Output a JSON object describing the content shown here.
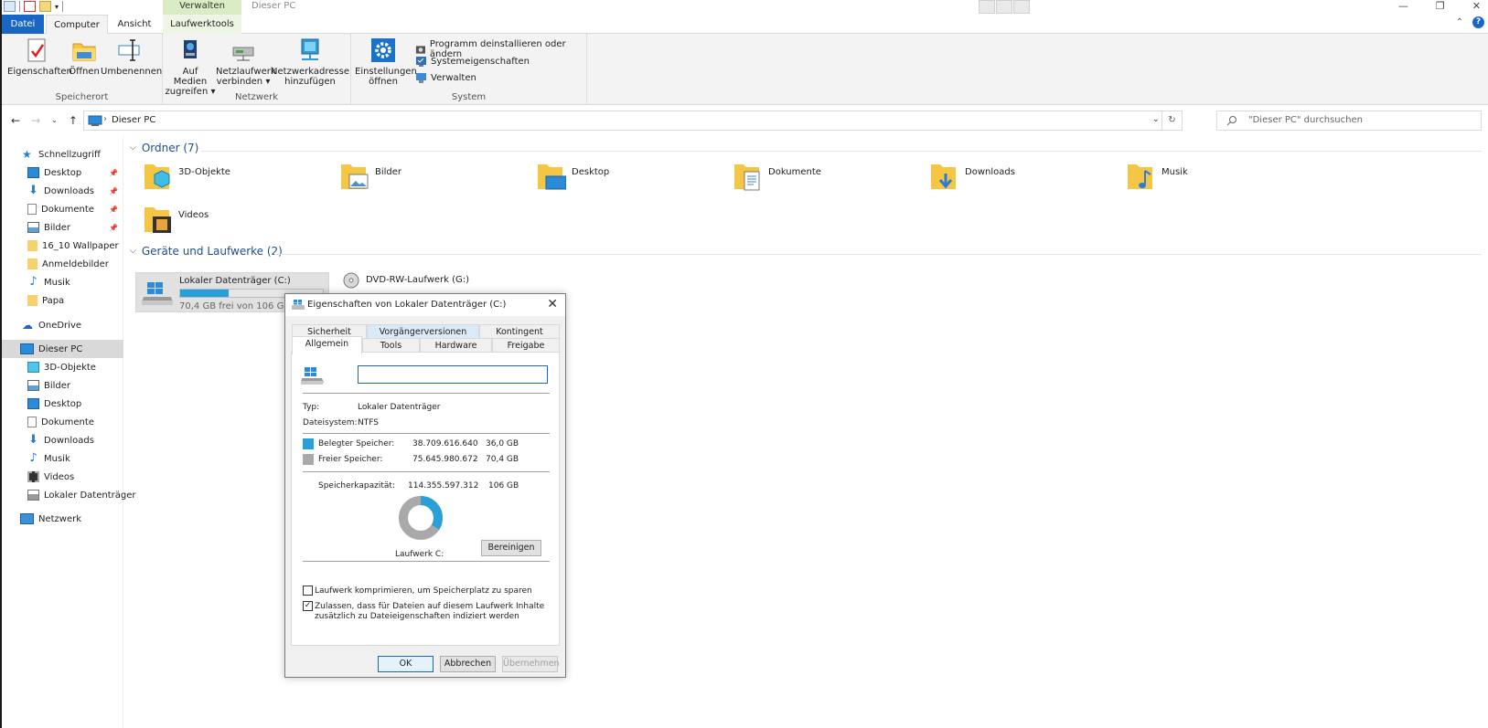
{
  "window": {
    "title": "Dieser PC",
    "context_tab_header": "Verwalten"
  },
  "tabs": {
    "datei": "Datei",
    "computer": "Computer",
    "ansicht": "Ansicht",
    "laufwerktools": "Laufwerktools"
  },
  "ribbon": {
    "groups": {
      "speicherort": "Speicherort",
      "netzwerk": "Netzwerk",
      "system": "System"
    },
    "buttons": {
      "eigenschaften": "Eigenschaften",
      "oeffnen": "Öffnen",
      "umbenennen": "Umbenennen",
      "auf_medien_1": "Auf Medien",
      "auf_medien_2": "zugreifen ▾",
      "netzlaufwerk_1": "Netzlaufwerk",
      "netzlaufwerk_2": "verbinden ▾",
      "netzwerkadresse_1": "Netzwerkadresse",
      "netzwerkadresse_2": "hinzufügen",
      "einstellungen_1": "Einstellungen",
      "einstellungen_2": "öffnen",
      "programm": "Programm deinstallieren oder ändern",
      "systemeigenschaften": "Systemeigenschaften",
      "verwalten": "Verwalten"
    }
  },
  "address": {
    "crumb": "Dieser PC",
    "search_placeholder": "\"Dieser PC\" durchsuchen"
  },
  "nav": {
    "schnellzugriff": "Schnellzugriff",
    "desktop": "Desktop",
    "downloads": "Downloads",
    "dokumente": "Dokumente",
    "bilder": "Bilder",
    "wallpaper": "16_10 Wallpaper",
    "anmeldebilder": "Anmeldebilder",
    "musik": "Musik",
    "papa": "Papa",
    "onedrive": "OneDrive",
    "dieser_pc": "Dieser PC",
    "objekte3d": "3D-Objekte",
    "bilder2": "Bilder",
    "desktop2": "Desktop",
    "dokumente2": "Dokumente",
    "downloads2": "Downloads",
    "musik2": "Musik",
    "videos": "Videos",
    "lokaler": "Lokaler Datenträger",
    "netzwerk": "Netzwerk"
  },
  "sections": {
    "ordner": "Ordner (7)",
    "geraete": "Geräte und Laufwerke (2)"
  },
  "folders": {
    "f1": "3D-Objekte",
    "f2": "Bilder",
    "f3": "Desktop",
    "f4": "Dokumente",
    "f5": "Downloads",
    "f6": "Musik",
    "f7": "Videos"
  },
  "drives": {
    "c_name": "Lokaler Datenträger (C:)",
    "c_free": "70,4 GB frei von 106 GB",
    "c_used_fraction": 0.34,
    "dvd_name": "DVD-RW-Laufwerk (G:)"
  },
  "dialog": {
    "title": "Eigenschaften von Lokaler Datenträger (C:)",
    "tabs": {
      "sicherheit": "Sicherheit",
      "vorgaenger": "Vorgängerversionen",
      "kontingent": "Kontingent",
      "allgemein": "Allgemein",
      "tools": "Tools",
      "hardware": "Hardware",
      "freigabe": "Freigabe"
    },
    "name_value": "",
    "typ_label": "Typ:",
    "typ_value": "Lokaler Datenträger",
    "fs_label": "Dateisystem:",
    "fs_value": "NTFS",
    "used_label": "Belegter Speicher:",
    "used_bytes": "38.709.616.640",
    "used_gb": "36,0 GB",
    "free_label": "Freier Speicher:",
    "free_bytes": "75.645.980.672",
    "free_gb": "70,4 GB",
    "cap_label": "Speicherkapazität:",
    "cap_bytes": "114.355.597.312",
    "cap_gb": "106 GB",
    "drive_label": "Laufwerk C:",
    "bereinigen": "Bereinigen",
    "compress_label": "Laufwerk komprimieren, um Speicherplatz zu sparen",
    "index_label_1": "Zulassen, dass für Dateien auf diesem Laufwerk Inhalte",
    "index_label_2": "zusätzlich zu Dateieigenschaften indiziert werden",
    "ok": "OK",
    "abbrechen": "Abbrechen",
    "uebernehmen": "Übernehmen",
    "used_color": "#2a9fd8",
    "free_color": "#a9a9a9"
  }
}
